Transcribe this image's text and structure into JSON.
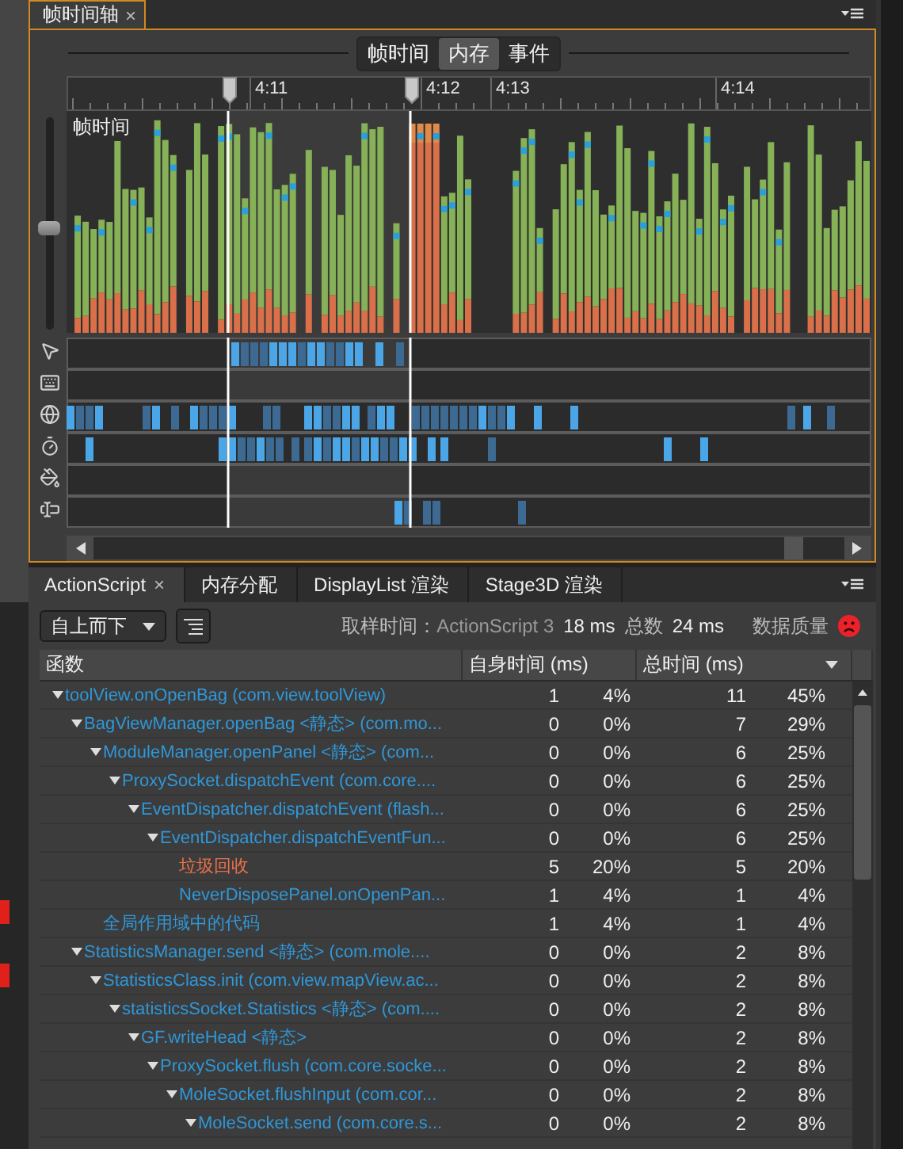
{
  "timeline_panel": {
    "tab": {
      "label": "帧时间轴",
      "close": "×"
    },
    "views": [
      {
        "label": "帧时间",
        "selected": false
      },
      {
        "label": "内存",
        "selected": true
      },
      {
        "label": "事件",
        "selected": false
      }
    ],
    "time_labels": [
      "4:11",
      "4:12",
      "4:13",
      "4:14"
    ],
    "chart_label": "帧时间",
    "zoom_slider": {
      "level": 0.48
    }
  },
  "profiler_panel": {
    "tabs": [
      {
        "label": "ActionScript",
        "selected": true,
        "close": "×"
      },
      {
        "label": "内存分配",
        "selected": false
      },
      {
        "label": "DisplayList 渲染",
        "selected": false
      },
      {
        "label": "Stage3D 渲染",
        "selected": false
      }
    ],
    "order_dropdown": "自上而下",
    "sampling_label": "取样时间：",
    "sampling_target": "ActionScript 3",
    "sampling_value": "18 ms",
    "total_label": "总数",
    "total_value": "24 ms",
    "quality_label": "数据质量",
    "columns": [
      "函数",
      "自身时间 (ms)",
      "总时间 (ms)"
    ],
    "rows": [
      {
        "name": "toolView.onOpenBag (com.view.toolView)",
        "kind": "node",
        "self": "1",
        "self_pct": "4%",
        "total": "11",
        "total_pct": "45%",
        "children": [
          {
            "name": "BagViewManager.openBag <静态> (com.mo...",
            "kind": "node",
            "self": "0",
            "self_pct": "0%",
            "total": "7",
            "total_pct": "29%",
            "children": [
              {
                "name": "ModuleManager.openPanel <静态> (com...",
                "kind": "node",
                "self": "0",
                "self_pct": "0%",
                "total": "6",
                "total_pct": "25%",
                "children": [
                  {
                    "name": "ProxySocket.dispatchEvent (com.core....",
                    "kind": "node",
                    "self": "0",
                    "self_pct": "0%",
                    "total": "6",
                    "total_pct": "25%",
                    "children": [
                      {
                        "name": "EventDispatcher.dispatchEvent (flash...",
                        "kind": "node",
                        "self": "0",
                        "self_pct": "0%",
                        "total": "6",
                        "total_pct": "25%",
                        "children": [
                          {
                            "name": "EventDispatcher.dispatchEventFun...",
                            "kind": "node",
                            "self": "0",
                            "self_pct": "0%",
                            "total": "6",
                            "total_pct": "25%",
                            "children": [
                              {
                                "name": "垃圾回收",
                                "kind": "gc",
                                "self": "5",
                                "self_pct": "20%",
                                "total": "5",
                                "total_pct": "20%"
                              },
                              {
                                "name": "NeverDisposePanel.onOpenPan...",
                                "kind": "leaf",
                                "self": "1",
                                "self_pct": "4%",
                                "total": "1",
                                "total_pct": "4%"
                              }
                            ]
                          }
                        ]
                      }
                    ]
                  }
                ]
              },
              {
                "name": "全局作用域中的代码",
                "kind": "leaf",
                "self": "1",
                "self_pct": "4%",
                "total": "1",
                "total_pct": "4%"
              }
            ]
          },
          {
            "name": "StatisticsManager.send <静态> (com.mole....",
            "kind": "node",
            "self": "0",
            "self_pct": "0%",
            "total": "2",
            "total_pct": "8%",
            "children": [
              {
                "name": "StatisticsClass.init (com.view.mapView.ac...",
                "kind": "node",
                "self": "0",
                "self_pct": "0%",
                "total": "2",
                "total_pct": "8%",
                "children": [
                  {
                    "name": "statisticsSocket.Statistics <静态> (com....",
                    "kind": "node",
                    "self": "0",
                    "self_pct": "0%",
                    "total": "2",
                    "total_pct": "8%",
                    "children": [
                      {
                        "name": "GF.writeHead <静态>",
                        "kind": "node",
                        "self": "0",
                        "self_pct": "0%",
                        "total": "2",
                        "total_pct": "8%",
                        "children": [
                          {
                            "name": "ProxySocket.flush (com.core.socke...",
                            "kind": "node",
                            "self": "0",
                            "self_pct": "0%",
                            "total": "2",
                            "total_pct": "8%",
                            "children": [
                              {
                                "name": "MoleSocket.flushInput (com.cor...",
                                "kind": "node",
                                "self": "0",
                                "self_pct": "0%",
                                "total": "2",
                                "total_pct": "8%",
                                "children": [
                                  {
                                    "name": "MoleSocket.send (com.core.s...",
                                    "kind": "node",
                                    "self": "0",
                                    "self_pct": "0%",
                                    "total": "2",
                                    "total_pct": "8%"
                                  }
                                ]
                              }
                            ]
                          }
                        ]
                      }
                    ]
                  }
                ]
              }
            ]
          }
        ]
      }
    ]
  }
}
